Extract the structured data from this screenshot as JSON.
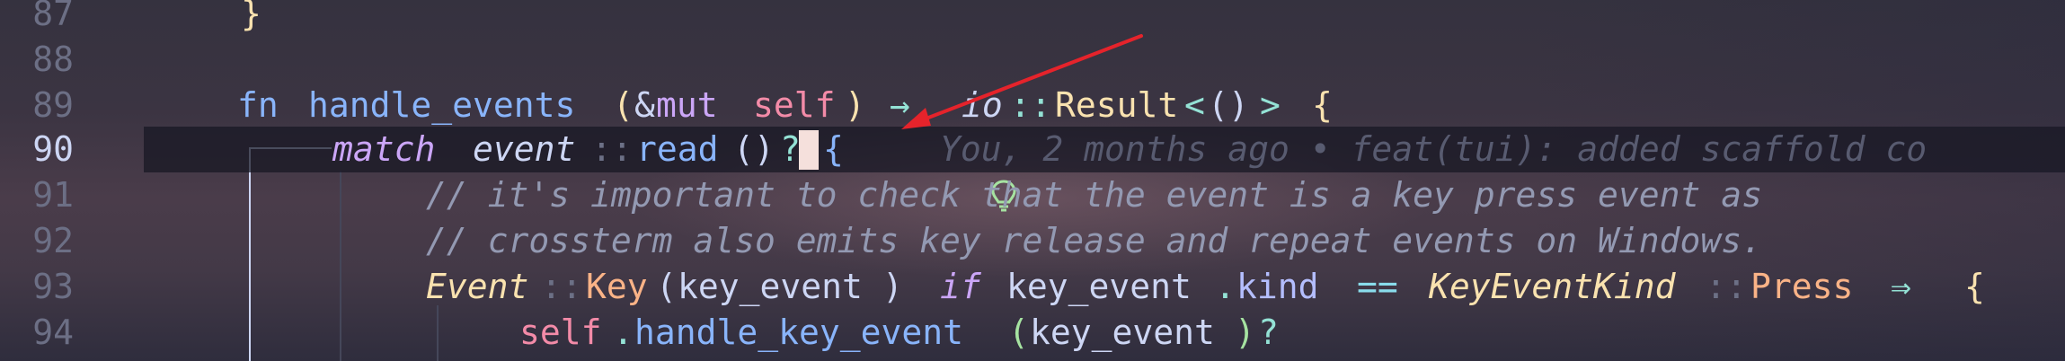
{
  "editor": {
    "line_numbers": [
      "87",
      "88",
      "89",
      "90",
      "91",
      "92",
      "93",
      "94"
    ],
    "current_line": "90"
  },
  "lines": {
    "l87": {
      "brace": "}"
    },
    "l89": {
      "fn": "fn",
      "name": "handle_events",
      "open": "(",
      "amp": "&",
      "mut": "mut",
      "self": "self",
      "close": ")",
      "arrow": "→",
      "ns": "io",
      "sep": "::",
      "result": "Result",
      "lt": "<",
      "unit": "()",
      "gt": ">",
      "brace": "{"
    },
    "l90": {
      "match": "match",
      "event": "event",
      "sep": "::",
      "read": "read",
      "call": "()",
      "q": "?",
      "brace": "{",
      "blame": "You, 2 months ago • feat(tui): added scaffold co"
    },
    "l91": {
      "comment": "// it's important to check that the event is a key press event as"
    },
    "l92": {
      "comment": "// crossterm also emits key release and repeat events on Windows."
    },
    "l93": {
      "enum": "Event",
      "sep1": "::",
      "variant": "Key",
      "open": "(",
      "arg": "key_event",
      "close": ")",
      "if": "if",
      "var": "key_event",
      "dot": ".",
      "field": "kind",
      "eq": "==",
      "kind_type": "KeyEventKind",
      "sep2": "::",
      "press": "Press",
      "fat_arrow": "⇒",
      "brace": "{"
    },
    "l94": {
      "self": "self",
      "dot": ".",
      "method": "handle_key_event",
      "open": "(",
      "arg": "key_event",
      "close": ")",
      "q": "?"
    }
  },
  "icons": {
    "lightbulb": "lightbulb-icon",
    "annotation": "red-arrow-annotation"
  },
  "colors": {
    "annotation_arrow": "#e5232b",
    "lightbulb": "#a6e3a1"
  }
}
